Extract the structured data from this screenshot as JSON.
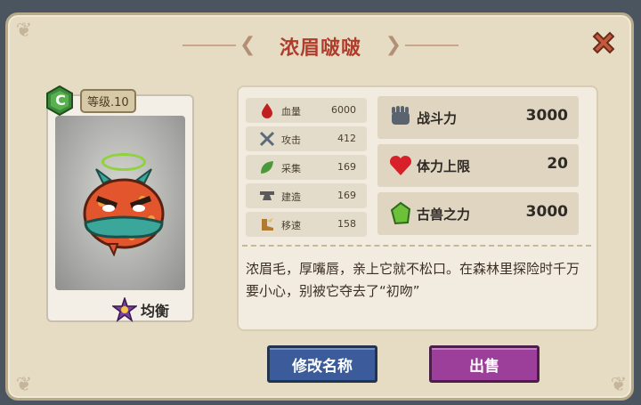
{
  "dialog": {
    "title": "浓眉啵啵"
  },
  "card": {
    "grade": "C",
    "level_label": "等级.10",
    "trait": "均衡"
  },
  "stats": [
    {
      "icon": "blood-drop-icon",
      "label": "血量",
      "value": "6000"
    },
    {
      "icon": "crossed-swords-icon",
      "label": "攻击",
      "value": "412"
    },
    {
      "icon": "leaf-icon",
      "label": "采集",
      "value": "169"
    },
    {
      "icon": "anvil-icon",
      "label": "建造",
      "value": "169"
    },
    {
      "icon": "winged-boot-icon",
      "label": "移速",
      "value": "158"
    }
  ],
  "big_stats": [
    {
      "icon": "fist-icon",
      "label": "战斗力",
      "value": "3000"
    },
    {
      "icon": "heart-icon",
      "label": "体力上限",
      "value": "20"
    },
    {
      "icon": "green-gem-icon",
      "label": "古兽之力",
      "value": "3000"
    }
  ],
  "description": "浓眉毛，厚嘴唇，亲上它就不松口。在森林里探险时千万要小心，别被它夺去了“初吻”",
  "buttons": {
    "rename": "修改名称",
    "sell": "出售"
  },
  "colors": {
    "title": "#b03d2c",
    "rename_btn": "#3b5b9a",
    "sell_btn": "#9c3f9a"
  }
}
